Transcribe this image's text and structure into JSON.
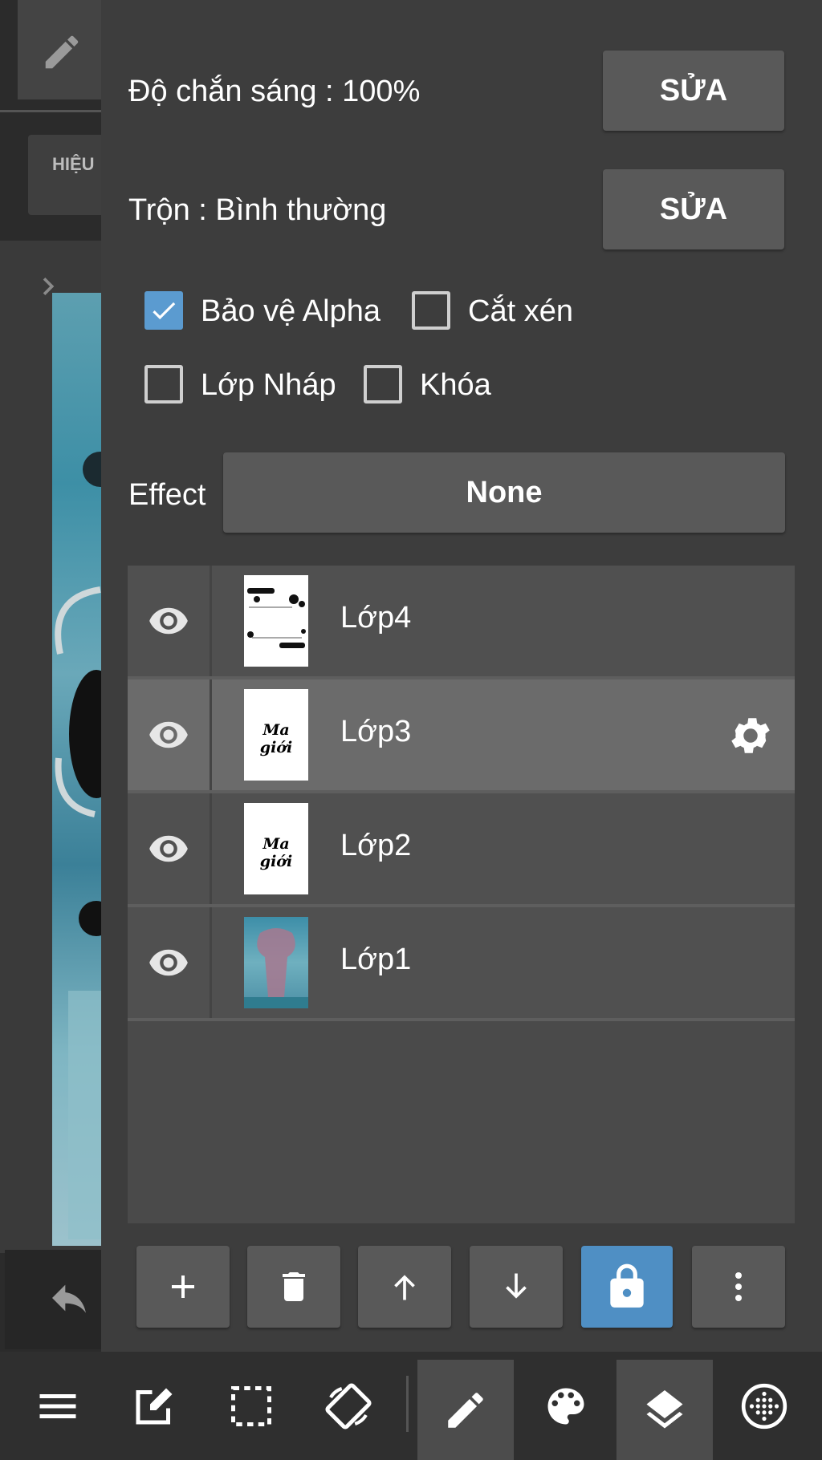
{
  "left_strip": {
    "effect_tab_label": "HIỆU"
  },
  "properties": {
    "opacity_label": "Độ chắn sáng : 100%",
    "opacity_edit_label": "SỬA",
    "blend_label": "Trộn : Bình thường",
    "blend_edit_label": "SỬA",
    "checkboxes": [
      {
        "label": "Bảo vệ Alpha",
        "checked": true
      },
      {
        "label": "Cắt xén",
        "checked": false
      },
      {
        "label": "Lớp Nháp",
        "checked": false
      },
      {
        "label": "Khóa",
        "checked": false
      }
    ],
    "effect_label": "Effect",
    "effect_value": "None"
  },
  "layers": [
    {
      "name": "Lớp4",
      "visible": true,
      "selected": false,
      "thumb": "sketch"
    },
    {
      "name": "Lớp3",
      "visible": true,
      "selected": true,
      "thumb": "text",
      "thumb_text": "Ma giới"
    },
    {
      "name": "Lớp2",
      "visible": true,
      "selected": false,
      "thumb": "text",
      "thumb_text": "Ma giới"
    },
    {
      "name": "Lớp1",
      "visible": true,
      "selected": false,
      "thumb": "image"
    }
  ],
  "layer_toolbar": [
    "add-icon",
    "trash-icon",
    "arrow-up-icon",
    "arrow-down-icon",
    "lock-icon",
    "more-vertical-icon"
  ],
  "bottom_bar": [
    "menu-icon",
    "edit-icon",
    "selection-icon",
    "rotate-icon",
    "brush-icon",
    "palette-icon",
    "layers-icon",
    "grid-icon"
  ],
  "colors": {
    "accent": "#4f8fc4",
    "panel": "#3d3d3d",
    "selected_row": "#6b6b6b"
  }
}
